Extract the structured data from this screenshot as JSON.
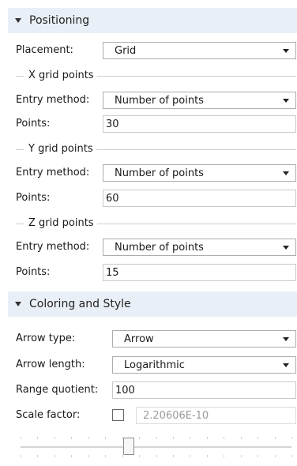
{
  "positioning": {
    "header": "Positioning",
    "placement": {
      "label": "Placement:",
      "value": "Grid"
    },
    "x_group": {
      "label": "X grid points",
      "entry_method": {
        "label": "Entry method:",
        "value": "Number of points"
      },
      "points": {
        "label": "Points:",
        "value": "30"
      }
    },
    "y_group": {
      "label": "Y grid points",
      "entry_method": {
        "label": "Entry method:",
        "value": "Number of points"
      },
      "points": {
        "label": "Points:",
        "value": "60"
      }
    },
    "z_group": {
      "label": "Z grid points",
      "entry_method": {
        "label": "Entry method:",
        "value": "Number of points"
      },
      "points": {
        "label": "Points:",
        "value": "15"
      }
    }
  },
  "coloring": {
    "header": "Coloring and Style",
    "arrow_type": {
      "label": "Arrow type:",
      "value": "Arrow"
    },
    "arrow_length": {
      "label": "Arrow length:",
      "value": "Logarithmic"
    },
    "range_quotient": {
      "label": "Range quotient:",
      "value": "100"
    },
    "scale_factor": {
      "label": "Scale factor:",
      "checked": false,
      "value": "2.20606E-10",
      "slider_fraction": 0.4
    }
  },
  "icons": {
    "section_caret": "caret-down-icon",
    "dropdown_arrow": "chevron-down-icon"
  }
}
